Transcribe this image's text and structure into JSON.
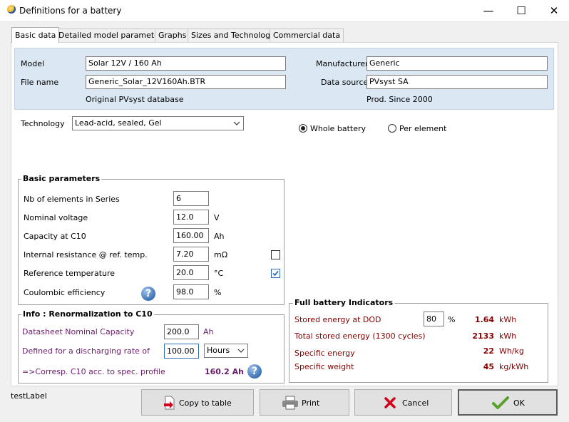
{
  "window": {
    "title": "Definitions for a battery",
    "minimize": "—",
    "maximize": "☐",
    "close": "✕"
  },
  "tabs": [
    {
      "label": "Basic data"
    },
    {
      "label": "Detailed model parameters"
    },
    {
      "label": "Graphs"
    },
    {
      "label": "Sizes and Technology"
    },
    {
      "label": "Commercial data"
    }
  ],
  "identity": {
    "model_label": "Model",
    "model_value": "Solar 12V / 160 Ah",
    "file_label": "File name",
    "file_value": "Generic_Solar_12V160Ah.BTR",
    "database_note": "Original PVsyst database",
    "manufacturer_label": "Manufacturer",
    "manufacturer_value": "Generic",
    "source_label": "Data source",
    "source_value": "PVsyst SA",
    "prod_note": "Prod. Since 2000"
  },
  "technology": {
    "label": "Technology",
    "value": "Lead-acid, sealed, Gel"
  },
  "scope": {
    "whole_label": "Whole battery",
    "element_label": "Per element",
    "selected": "whole"
  },
  "basic": {
    "title": "Basic parameters",
    "rows": [
      {
        "label": "Nb of elements in Series",
        "value": "6",
        "unit": ""
      },
      {
        "label": "Nominal voltage",
        "value": "12.0",
        "unit": "V"
      },
      {
        "label": "Capacity at C10",
        "value": "160.00",
        "unit": "Ah"
      },
      {
        "label": "Internal resistance @ ref. temp.",
        "value": "7.20",
        "unit": "mΩ"
      },
      {
        "label": "Reference temperature",
        "value": "20.0",
        "unit": "°C"
      },
      {
        "label": "Coulombic efficiency",
        "value": "98.0",
        "unit": "%"
      }
    ],
    "resistance_checked": false,
    "temperature_checked": true,
    "help": "?"
  },
  "renorm": {
    "title": "Info : Renormalization to C10",
    "nominal_label": "Datasheet Nominal Capacity",
    "nominal_value": "200.0",
    "nominal_unit": "Ah",
    "rate_label": "Defined for a discharging rate of",
    "rate_value": "100.00",
    "rate_unit": "Hours",
    "corresp_label": "=>Corresp. C10 acc. to spec. profile",
    "corresp_value": "160.2 Ah",
    "help": "?"
  },
  "indicators": {
    "title": "Full battery Indicators",
    "dod_label": "Stored energy at DOD",
    "dod_value": "80",
    "dod_unit": "%",
    "dod_result": "1.64",
    "dod_result_unit": "kWh",
    "total_label": "Total stored energy (1300 cycles)",
    "total_value": "2133",
    "total_unit": "kWh",
    "spec_energy_label": "Specific energy",
    "spec_energy_value": "22",
    "spec_energy_unit": "Wh/kg",
    "spec_weight_label": "Specific weight",
    "spec_weight_value": "45",
    "spec_weight_unit": "kg/kWh"
  },
  "footer": {
    "test_label": "testLabel",
    "copy_label": "Copy to table",
    "print_label": "Print",
    "cancel_label": "Cancel",
    "ok_label": "OK"
  }
}
